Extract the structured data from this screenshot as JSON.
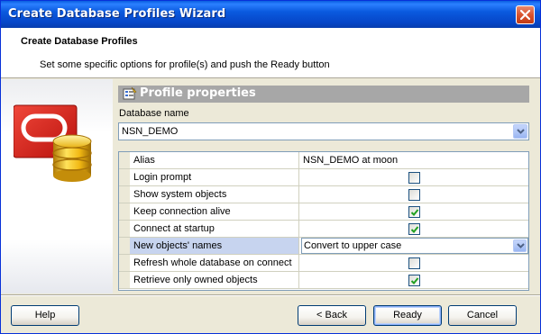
{
  "window": {
    "title": "Create Database Profiles Wizard"
  },
  "header": {
    "title": "Create Database Profiles",
    "subtitle": "Set some specific options for profile(s) and push the Ready button"
  },
  "section": {
    "title": "Profile properties"
  },
  "database": {
    "label": "Database name",
    "value": "NSN_DEMO"
  },
  "properties": [
    {
      "name": "Alias",
      "type": "text",
      "value": "NSN_DEMO at moon"
    },
    {
      "name": "Login prompt",
      "type": "checkbox",
      "checked": false
    },
    {
      "name": "Show system objects",
      "type": "checkbox",
      "checked": false
    },
    {
      "name": "Keep connection alive",
      "type": "checkbox",
      "checked": true
    },
    {
      "name": "Connect at startup",
      "type": "checkbox",
      "checked": true
    },
    {
      "name": "New objects' names",
      "type": "select",
      "value": "Convert to upper case",
      "selected": true
    },
    {
      "name": "Refresh whole database on connect",
      "type": "checkbox",
      "checked": false
    },
    {
      "name": "Retrieve only owned objects",
      "type": "checkbox",
      "checked": true
    }
  ],
  "buttons": {
    "help": "Help",
    "back": "< Back",
    "ready": "Ready",
    "cancel": "Cancel"
  },
  "colors": {
    "titlebar": "#0a5adf",
    "section_header": "#a7a7a7",
    "selected_row": "#c7d4ef",
    "check_green": "#21a121"
  }
}
